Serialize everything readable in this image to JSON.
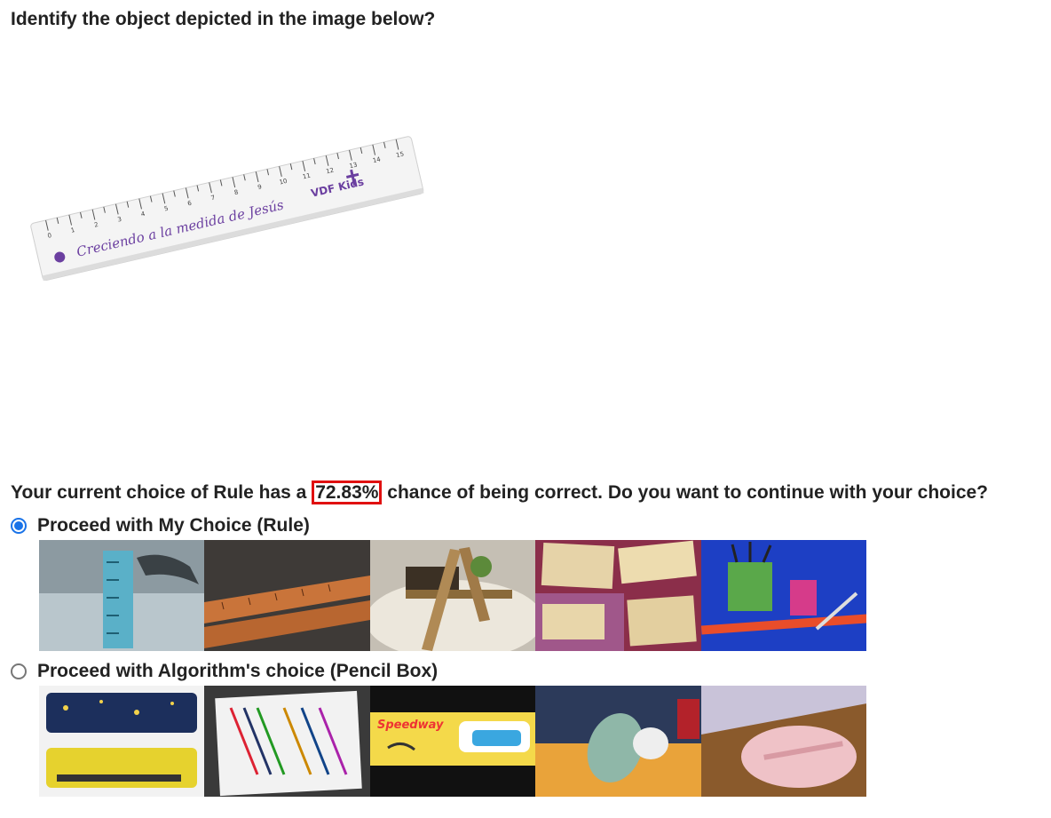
{
  "question": "Identify the object depicted in the image below?",
  "ruler_text": "Creciendo a la medida de Jesús",
  "ruler_brand": "VDF Kids",
  "prompt": {
    "before": "Your current choice of Rule has a ",
    "percent": "72.83%",
    "after": " chance of being correct. Do you want to continue with your choice?"
  },
  "options": [
    {
      "label": "Proceed with My Choice (Rule)",
      "selected": true
    },
    {
      "label": "Proceed with Algorithm's choice (Pencil Box)",
      "selected": false
    }
  ],
  "thumb_text": {
    "speedway": "Speedway"
  },
  "colors": {
    "highlight_border": "#e01010",
    "radio_selected": "#1a73e8",
    "ruler_print": "#6b3fa0"
  }
}
